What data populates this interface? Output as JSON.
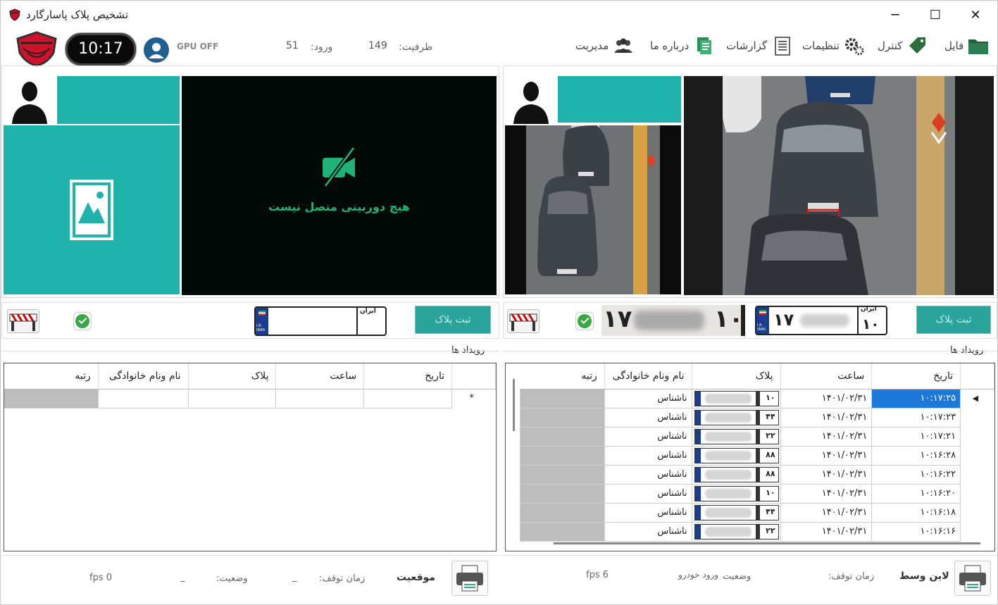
{
  "window": {
    "title": "تشخیص پلاک پاسارگارد",
    "minimize": "─",
    "maximize": "☐",
    "close": "✕"
  },
  "header": {
    "time": "10:17",
    "gpu": "GPU OFF",
    "entry_label": "ورود:",
    "entry_value": "51",
    "capacity_label": "ظرفیت:",
    "capacity_value": "149",
    "menu": [
      "فایل",
      "کنترل",
      "تنظیمات",
      "گزارشات",
      "درباره ما",
      "مدیریت"
    ]
  },
  "left_panel": {
    "no_camera_text": "هیچ دوربینی متصل نیست",
    "register_button": "ثبت پلاک",
    "plate_header": "ایران",
    "events_title": "رویداد ها",
    "columns": [
      "تاریخ",
      "ساعت",
      "پلاک",
      "نام ونام خانوادگی",
      "رتبه"
    ],
    "new_row_marker": "*",
    "footer": {
      "mode": "موقعیت",
      "stop_label": "زمان توقف:",
      "stop_value": "_",
      "status_label": "وضعیت:",
      "status_value": "_",
      "fps": "fps 0"
    }
  },
  "right_panel": {
    "register_button": "ثبت پلاک",
    "plate_header": "ایران",
    "plate_left": "۱۷",
    "plate_right": "۱۰",
    "events_title": "رویداد ها",
    "columns": [
      "تاریخ",
      "ساعت",
      "پلاک",
      "نام ونام خانوادگی",
      "رتبه"
    ],
    "rows": [
      {
        "date": "۱۰:۱۷:۲۵",
        "time": "۱۴۰۱/۰۲/۳۱",
        "name": "ناشناس",
        "p": "۱۰",
        "selected": true
      },
      {
        "date": "۱۰:۱۷:۲۳",
        "time": "۱۴۰۱/۰۲/۳۱",
        "name": "ناشناس",
        "p": "۴۴"
      },
      {
        "date": "۱۰:۱۷:۲۱",
        "time": "۱۴۰۱/۰۲/۳۱",
        "name": "ناشناس",
        "p": "۲۲"
      },
      {
        "date": "۱۰:۱۶:۲۸",
        "time": "۱۴۰۱/۰۲/۳۱",
        "name": "ناشناس",
        "p": "۸۸"
      },
      {
        "date": "۱۰:۱۶:۲۲",
        "time": "۱۴۰۱/۰۲/۳۱",
        "name": "ناشناس",
        "p": "۸۸"
      },
      {
        "date": "۱۰:۱۶:۲۰",
        "time": "۱۴۰۱/۰۲/۳۱",
        "name": "ناشناس",
        "p": "۱۰"
      },
      {
        "date": "۱۰:۱۶:۱۸",
        "time": "۱۴۰۱/۰۲/۳۱",
        "name": "ناشناس",
        "p": "۴۴"
      },
      {
        "date": "۱۰:۱۶:۱۶",
        "time": "۱۴۰۱/۰۲/۳۱",
        "name": "ناشناس",
        "p": "۲۲"
      }
    ],
    "footer": {
      "mode": "لاین وسط",
      "stop_label": "زمان توقف:",
      "status_label": "وضعیت",
      "status_value": "ورود خودرو",
      "fps": "fps 6"
    }
  },
  "colors": {
    "teal": "#1fb3ab",
    "selection": "#1e78d7",
    "camera_green": "#1fb37a"
  }
}
